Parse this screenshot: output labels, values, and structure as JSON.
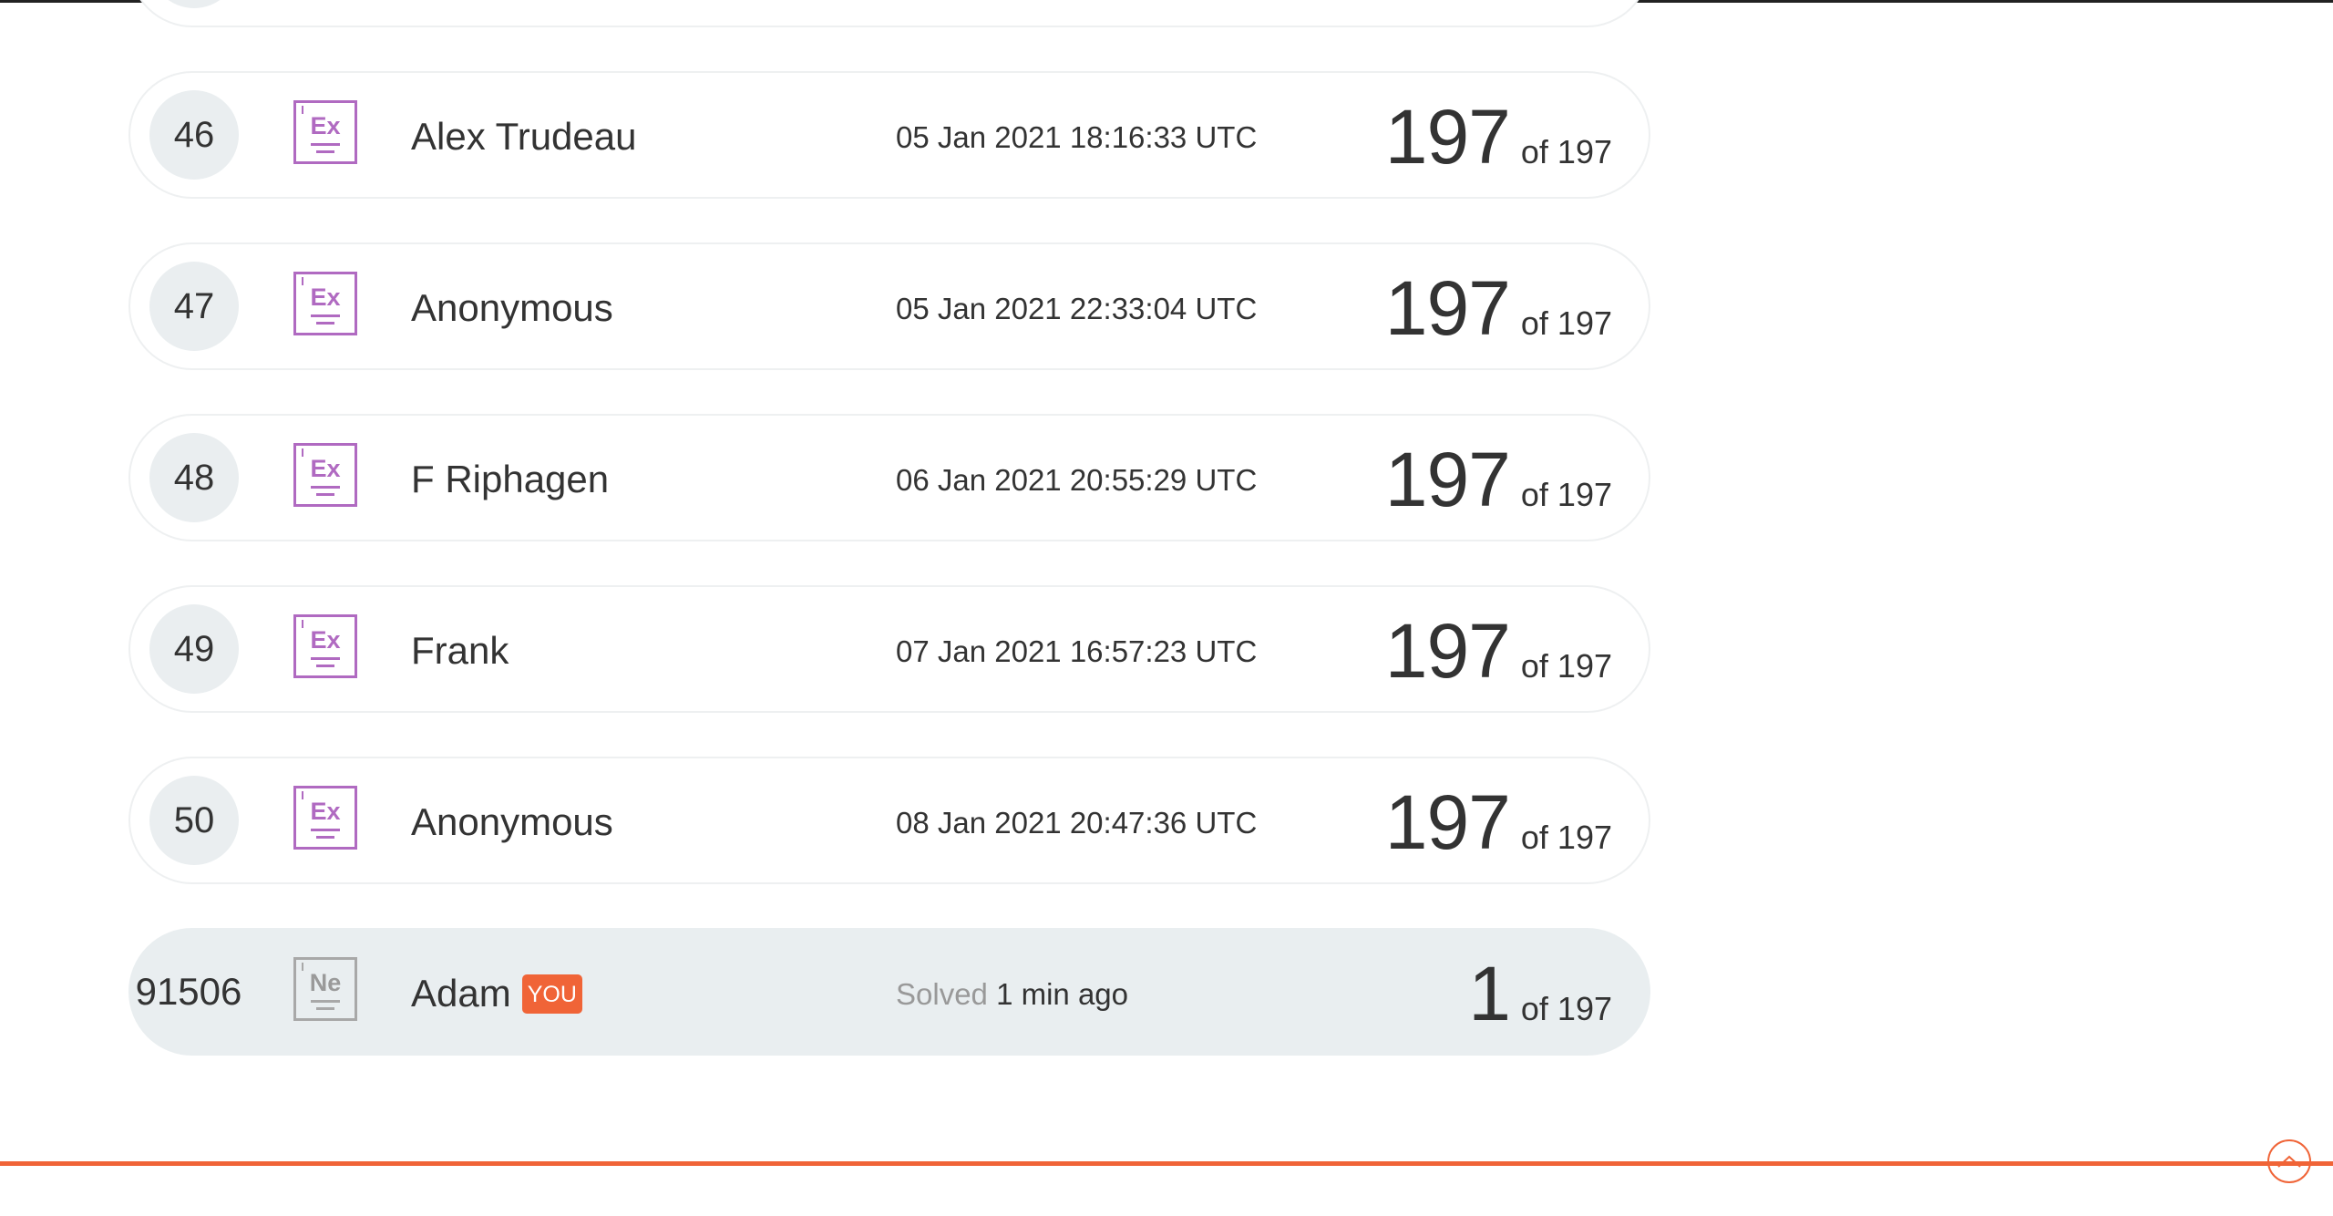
{
  "leaderboard": {
    "rows": [
      {
        "rank": "46",
        "level": "Ex",
        "name": "Alex Trudeau",
        "date": "05 Jan 2021 18:16:33 UTC",
        "score": "197",
        "of": "of 197"
      },
      {
        "rank": "47",
        "level": "Ex",
        "name": "Anonymous",
        "date": "05 Jan 2021 22:33:04 UTC",
        "score": "197",
        "of": "of 197"
      },
      {
        "rank": "48",
        "level": "Ex",
        "name": "F Riphagen",
        "date": "06 Jan 2021 20:55:29 UTC",
        "score": "197",
        "of": "of 197"
      },
      {
        "rank": "49",
        "level": "Ex",
        "name": "Frank",
        "date": "07 Jan 2021 16:57:23 UTC",
        "score": "197",
        "of": "of 197"
      },
      {
        "rank": "50",
        "level": "Ex",
        "name": "Anonymous",
        "date": "08 Jan 2021 20:47:36 UTC",
        "score": "197",
        "of": "of 197"
      }
    ],
    "you_row": {
      "rank": "91506",
      "level": "Ne",
      "name": "Adam",
      "badge": "YOU",
      "solved_label": "Solved",
      "solved_time": "1 min ago",
      "score": "1",
      "of": "of 197"
    }
  },
  "colors": {
    "accent": "#f06437",
    "level_ex": "#b06ac1",
    "level_ne": "#a8a8a8",
    "you_row_bg": "#e9eef0"
  },
  "icons": {
    "scroll_top": "chevron-up-icon"
  }
}
